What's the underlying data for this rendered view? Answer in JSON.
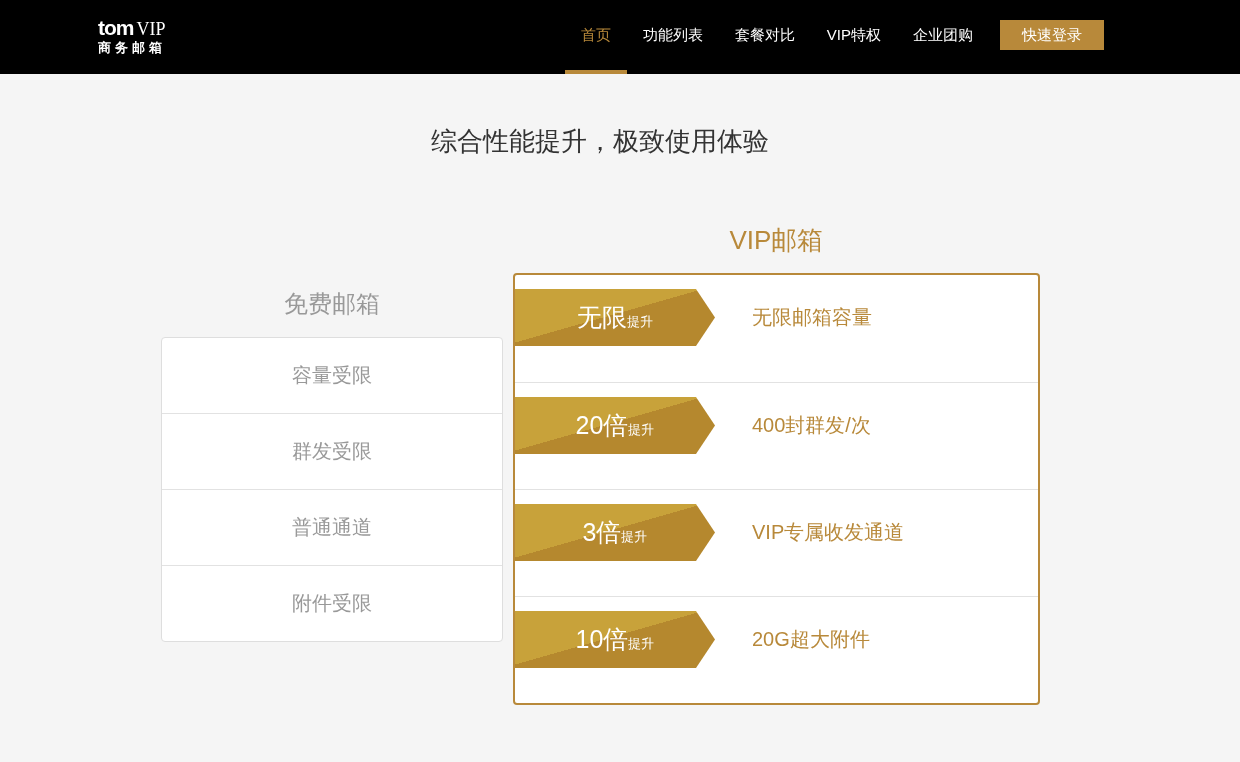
{
  "header": {
    "logo": {
      "brand": "tom",
      "tier": "VIP",
      "subtitle": "商务邮箱"
    },
    "nav": [
      {
        "label": "首页",
        "selected": true
      },
      {
        "label": "功能列表",
        "selected": false
      },
      {
        "label": "套餐对比",
        "selected": false
      },
      {
        "label": "VIP特权",
        "selected": false
      },
      {
        "label": "企业团购",
        "selected": false
      }
    ],
    "login_button": "快速登录"
  },
  "headline": "综合性能提升，极致使用体验",
  "free_plan": {
    "title": "免费邮箱",
    "items": [
      "容量受限",
      "群发受限",
      "普通通道",
      "附件受限"
    ]
  },
  "vip_plan": {
    "title": "VIP邮箱",
    "items": [
      {
        "boost": "无限",
        "suffix": "提升",
        "feature": "无限邮箱容量"
      },
      {
        "boost": "20倍",
        "suffix": "提升",
        "feature": "400封群发/次"
      },
      {
        "boost": "3倍",
        "suffix": "提升",
        "feature": "VIP专属收发通道"
      },
      {
        "boost": "10倍",
        "suffix": "提升",
        "feature": "20G超大附件"
      }
    ]
  }
}
